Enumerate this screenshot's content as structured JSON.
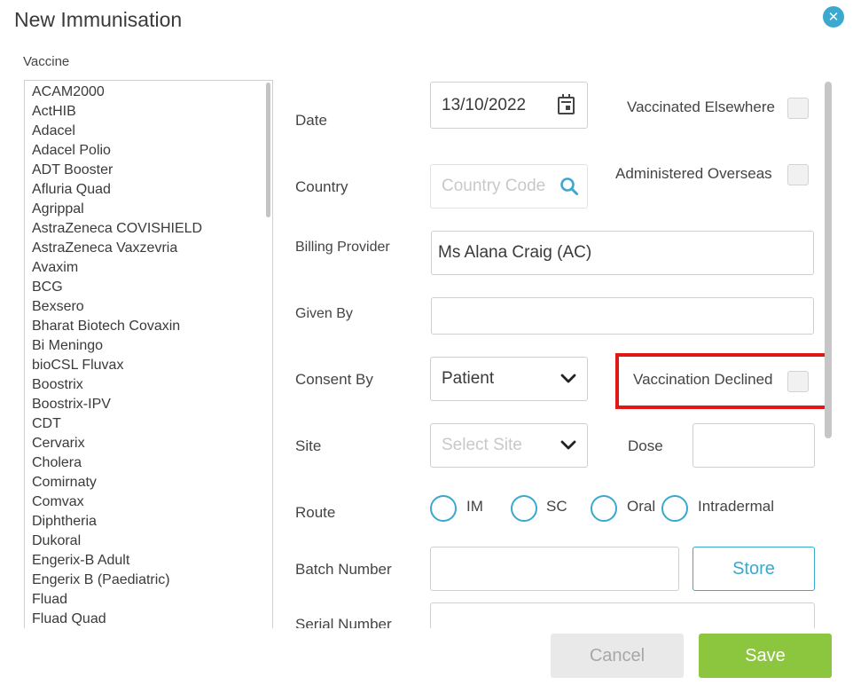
{
  "dialog": {
    "title": "New Immunisation",
    "close_icon": "close-icon",
    "close_glyph": "✕"
  },
  "vaccine": {
    "label": "Vaccine",
    "items": [
      "ACAM2000",
      "ActHIB",
      "Adacel",
      "Adacel Polio",
      "ADT Booster",
      "Afluria Quad",
      "Agrippal",
      "AstraZeneca COVISHIELD",
      "AstraZeneca Vaxzevria",
      "Avaxim",
      "BCG",
      "Bexsero",
      "Bharat Biotech Covaxin",
      "Bi Meningo",
      "bioCSL Fluvax",
      "Boostrix",
      "Boostrix-IPV",
      "CDT",
      "Cervarix",
      "Cholera",
      "Comirnaty",
      "Comvax",
      "Diphtheria",
      "Dukoral",
      "Engerix-B Adult",
      "Engerix B (Paediatric)",
      "Fluad",
      "Fluad Quad"
    ]
  },
  "form": {
    "date": {
      "label": "Date",
      "value": "13/10/2022",
      "icon": "calendar-icon"
    },
    "country": {
      "label": "Country",
      "placeholder": "Country Code",
      "icon": "search-icon"
    },
    "billing_provider": {
      "label": "Billing Provider",
      "value": "Ms Alana Craig (AC)"
    },
    "given_by": {
      "label": "Given By",
      "value": ""
    },
    "consent_by": {
      "label": "Consent By",
      "value": "Patient",
      "icon": "chevron-down-icon"
    },
    "site": {
      "label": "Site",
      "placeholder": "Select Site",
      "icon": "chevron-down-icon"
    },
    "dose": {
      "label": "Dose",
      "value": ""
    },
    "route": {
      "label": "Route",
      "options": [
        "IM",
        "SC",
        "Oral",
        "Intradermal"
      ]
    },
    "batch_number": {
      "label": "Batch Number",
      "value": "",
      "store_label": "Store"
    },
    "serial_number": {
      "label": "Serial Number",
      "value": ""
    },
    "vaccinated_elsewhere": {
      "label": "Vaccinated Elsewhere",
      "checked": false
    },
    "administered_overseas": {
      "label": "Administered Overseas",
      "checked": false
    },
    "vaccination_declined": {
      "label": "Vaccination Declined",
      "checked": false
    }
  },
  "footer": {
    "cancel_label": "Cancel",
    "save_label": "Save"
  },
  "colors": {
    "accent": "#3aa8cf",
    "save": "#8cc63f",
    "highlight": "#e01818",
    "cancel_bg": "#e9e9e9"
  }
}
